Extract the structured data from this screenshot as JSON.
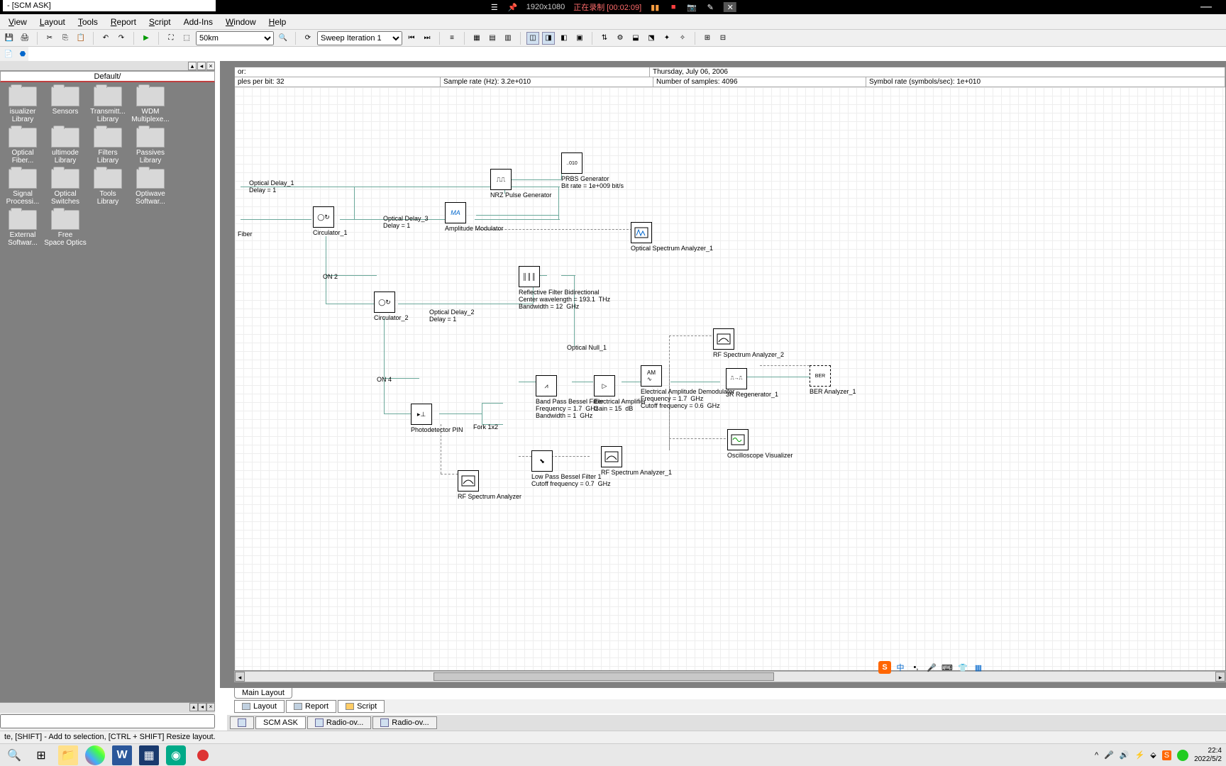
{
  "app_title": "- [SCM ASK]",
  "rec": {
    "resolution": "1920x1080",
    "status": "正在录制 [00:02:09]"
  },
  "menu": [
    "View",
    "Layout",
    "Tools",
    "Report",
    "Script",
    "Add-Ins",
    "Window",
    "Help"
  ],
  "toolbar": {
    "zoom": "50km",
    "sweep": "Sweep Iteration 1"
  },
  "lib": {
    "header": "Default/",
    "items": [
      "isualizer Library",
      "Sensors",
      "Transmitt... Library",
      "WDM Multiplexe...",
      "Optical Fiber...",
      "ultimode Library",
      "Filters Library",
      "Passives Library",
      "Signal Processi...",
      "Optical Switches",
      "Tools Library",
      "Optiwave Softwar...",
      "External Softwar...",
      "Free Space Optics"
    ]
  },
  "canvas": {
    "row1": {
      "c1": "or:",
      "c2": "Thursday, July 06, 2006"
    },
    "row2": {
      "c1": "ples per bit:  32",
      "c2": "Sample rate (Hz):  3.2e+010",
      "c3": "Number of samples:  4096",
      "c4": "Symbol rate (symbols/sec):  1e+010"
    }
  },
  "blocks": {
    "opt_delay1": "Optical Delay_1\nDelay = 1",
    "fiber": "Fiber",
    "circ1": "Circulator_1",
    "opt_delay3": "Optical Delay_3\nDelay = 1",
    "amp_mod": "Amplitude Modulator",
    "nrz": "NRZ Pulse Generator",
    "prbs": "PRBS Generator\nBit rate = 1e+009 bit/s",
    "osa1": "Optical Spectrum Analyzer_1",
    "on2": "ON 2",
    "circ2": "Circulator_2",
    "opt_delay2": "Optical Delay_2\nDelay = 1",
    "refl_filter": "Reflective Filter Bidirectional\nCenter wavelength = 193.1  THz\nBandwidth = 12  GHz",
    "opt_null": "Optical Null_1",
    "rf_sa2": "RF Spectrum Analyzer_2",
    "on4": "ON 4",
    "photodet": "Photodetector PIN",
    "fork": "Fork 1x2",
    "bpf": "Band Pass Bessel Filter\nFrequency = 1.7  GHz\nBandwidth = 1  GHz",
    "eamp": "Electrical Amplifier\nGain = 15  dB",
    "demod": "Electrical Amplitude Demodulator\nFrequency = 1.7  GHz\nCutoff frequency = 0.6  GHz",
    "regen": "3R Regenerator_1",
    "ber": "BER Analyzer_1",
    "lpf": "Low Pass Bessel Filter 1\nCutoff frequency = 0.7  GHz",
    "rf_sa1": "RF Spectrum Analyzer_1",
    "rf_sa": "RF Spectrum Analyzer",
    "osc_vis": "Oscilloscope Visualizer"
  },
  "main_tab": "Main Layout",
  "view_tabs": [
    "Layout",
    "Report",
    "Script"
  ],
  "docs": [
    "SCM ASK",
    "Radio-ov...",
    "Radio-ov..."
  ],
  "status": "te, [SHIFT] - Add to selection, [CTRL + SHIFT] Resize layout.",
  "tray": {
    "ime": "中",
    "time": "22:4",
    "date": "2022/5/2"
  },
  "sogou_ime": "中"
}
